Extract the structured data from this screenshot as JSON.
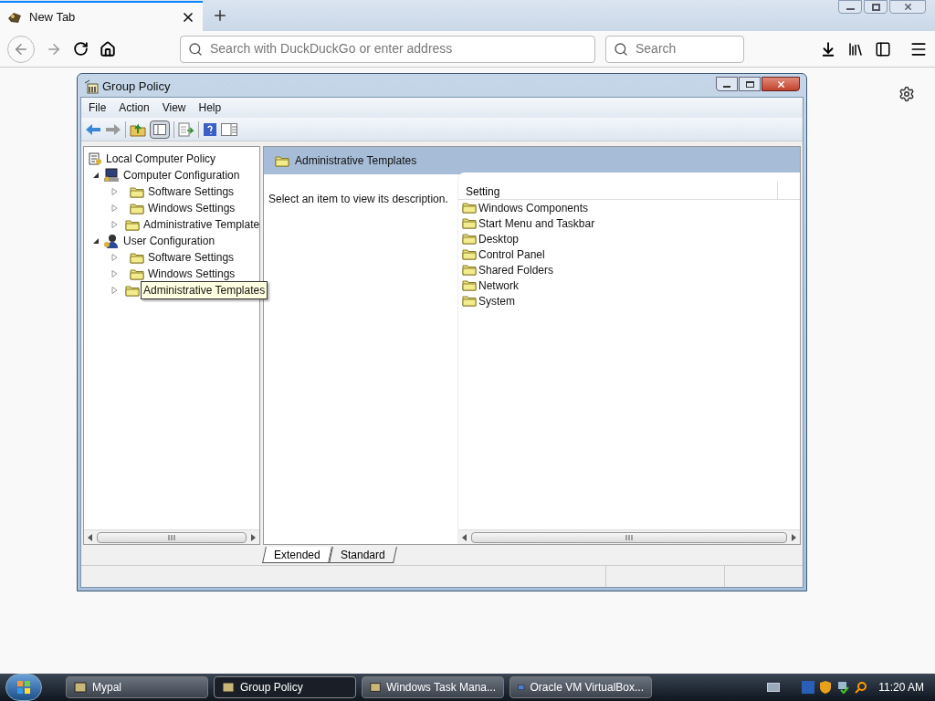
{
  "browser": {
    "tab": {
      "title": "New Tab"
    },
    "address": {
      "placeholder": "Search with DuckDuckGo or enter address"
    },
    "search": {
      "placeholder": "Search"
    }
  },
  "window": {
    "title": "Group Policy",
    "menu": [
      "File",
      "Action",
      "View",
      "Help"
    ],
    "tree": {
      "label": "Local Computer Policy",
      "children": [
        {
          "label": "Computer Configuration",
          "kind": "computer",
          "expanded": true,
          "children": [
            {
              "label": "Software Settings",
              "expanded": false,
              "tooltip": false
            },
            {
              "label": "Windows Settings",
              "expanded": false,
              "tooltip": false
            },
            {
              "label": "Administrative Template",
              "expanded": false,
              "tooltip": false
            }
          ]
        },
        {
          "label": "User Configuration",
          "kind": "user",
          "expanded": true,
          "children": [
            {
              "label": "Software Settings",
              "expanded": false,
              "tooltip": false
            },
            {
              "label": "Windows Settings",
              "expanded": false,
              "tooltip": false
            },
            {
              "label": "Administrative Templates",
              "expanded": false,
              "tooltip": true
            }
          ]
        }
      ]
    },
    "header": "Administrative Templates",
    "description": "Select an item to view its description.",
    "list": {
      "column": "Setting",
      "rows": [
        "Windows Components",
        "Start Menu and Taskbar",
        "Desktop",
        "Control Panel",
        "Shared Folders",
        "Network",
        "System"
      ]
    },
    "view_tabs": [
      {
        "label": "Extended",
        "selected": true
      },
      {
        "label": "Standard",
        "selected": false
      }
    ]
  },
  "taskbar": {
    "items": [
      {
        "label": "Mypal",
        "selected": false
      },
      {
        "label": "Group Policy",
        "selected": true
      },
      {
        "label": "Windows Task Mana...",
        "selected": false
      },
      {
        "label": "Oracle VM VirtualBox...",
        "selected": false
      }
    ],
    "clock": "11:20 AM"
  }
}
